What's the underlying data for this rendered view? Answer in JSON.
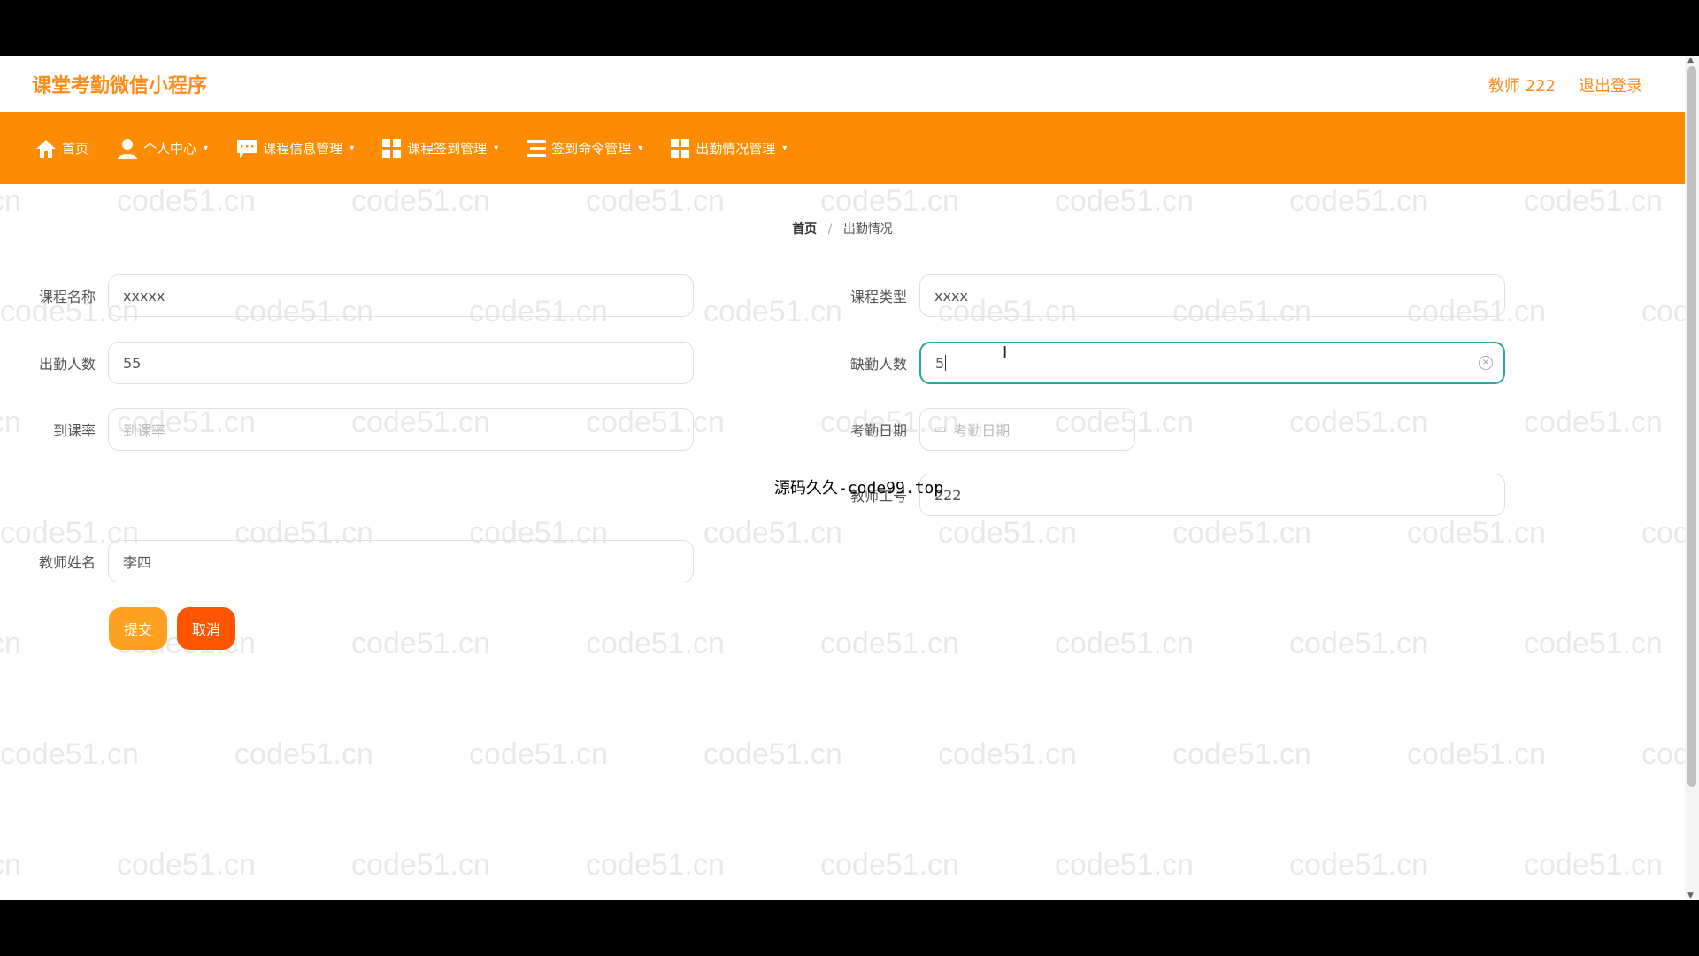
{
  "app": {
    "title": "课堂考勤微信小程序"
  },
  "user": {
    "name": "教师 222",
    "logout": "退出登录"
  },
  "nav": [
    {
      "label": "首页",
      "icon": "home-icon",
      "dropdown": false
    },
    {
      "label": "个人中心",
      "icon": "user-icon",
      "dropdown": true
    },
    {
      "label": "课程信息管理",
      "icon": "chat-icon",
      "dropdown": true
    },
    {
      "label": "课程签到管理",
      "icon": "grid-icon",
      "dropdown": true
    },
    {
      "label": "签到命令管理",
      "icon": "list-icon",
      "dropdown": true
    },
    {
      "label": "出勤情况管理",
      "icon": "grid-icon",
      "dropdown": true
    }
  ],
  "breadcrumb": {
    "home": "首页",
    "separator": "/",
    "current": "出勤情况"
  },
  "form": {
    "course_name": {
      "label": "课程名称",
      "value": "xxxxx"
    },
    "course_type": {
      "label": "课程类型",
      "value": "xxxx"
    },
    "attendance_count": {
      "label": "出勤人数",
      "value": "55"
    },
    "absence_count": {
      "label": "缺勤人数",
      "value": "5"
    },
    "attendance_rate": {
      "label": "到课率",
      "placeholder": "到课率"
    },
    "attendance_date": {
      "label": "考勤日期",
      "placeholder": "考勤日期"
    },
    "teacher_id": {
      "label": "教师工号",
      "value": "222"
    },
    "teacher_name": {
      "label": "教师姓名",
      "value": "李四"
    }
  },
  "buttons": {
    "submit": "提交",
    "cancel": "取消"
  },
  "overlay": {
    "text": "源码久久-code99.top"
  },
  "watermark": {
    "text": "code51.cn"
  },
  "colors": {
    "accent": "#ff8c00",
    "title": "#ff8c1a",
    "cancel": "#ff5500",
    "focus": "#2aa6a0"
  }
}
